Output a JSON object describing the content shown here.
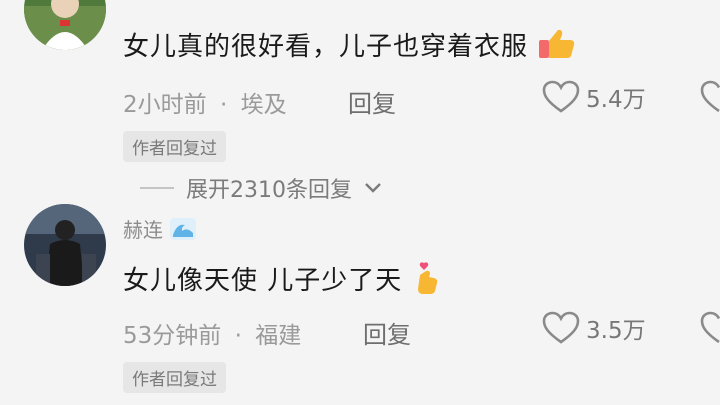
{
  "comment1": {
    "username": "",
    "text": "女儿真的很好看，儿子也穿着衣服",
    "time": "2小时前",
    "separator": "·",
    "location": "埃及",
    "reply_label": "回复",
    "likes": "5.4万",
    "author_badge": "作者回复过",
    "emoji": "thumbs-up-emoji"
  },
  "expand": {
    "label": "展开2310条回复"
  },
  "comment2": {
    "username": "赫连",
    "text": "女儿像天使 儿子少了天",
    "time": "53分钟前",
    "separator": "·",
    "location": "福建",
    "reply_label": "回复",
    "likes": "3.5万",
    "author_badge": "作者回复过",
    "emoji": "finger-heart-emoji",
    "username_emoji": "wave-emoji"
  }
}
